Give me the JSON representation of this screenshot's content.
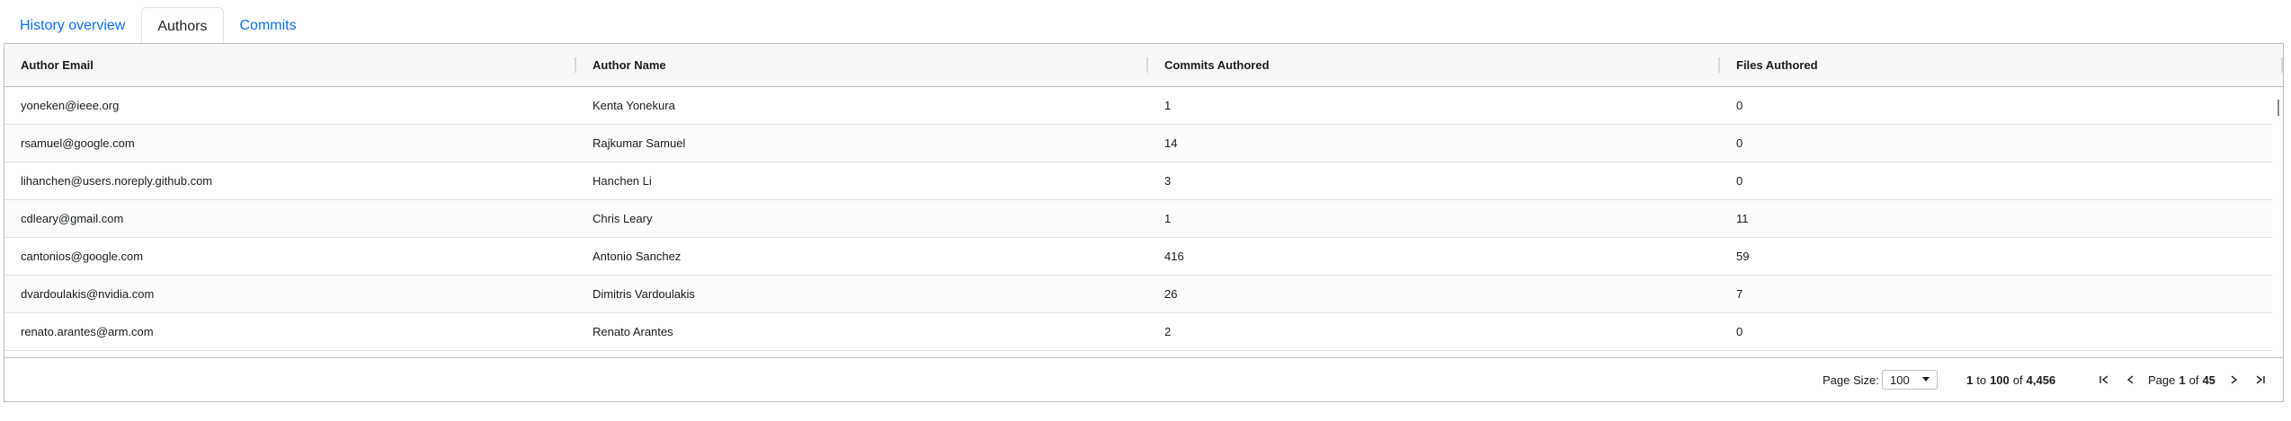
{
  "tabs": [
    {
      "label": "History overview",
      "active": false
    },
    {
      "label": "Authors",
      "active": true
    },
    {
      "label": "Commits",
      "active": false
    }
  ],
  "columns": [
    "Author Email",
    "Author Name",
    "Commits Authored",
    "Files Authored"
  ],
  "rows": [
    [
      "yoneken@ieee.org",
      "Kenta Yonekura",
      "1",
      "0"
    ],
    [
      "rsamuel@google.com",
      "Rajkumar Samuel",
      "14",
      "0"
    ],
    [
      "lihanchen@users.noreply.github.com",
      "Hanchen Li",
      "3",
      "0"
    ],
    [
      "cdleary@gmail.com",
      "Chris Leary",
      "1",
      "11"
    ],
    [
      "cantonios@google.com",
      "Antonio Sanchez",
      "416",
      "59"
    ],
    [
      "dvardoulakis@nvidia.com",
      "Dimitris Vardoulakis",
      "26",
      "7"
    ],
    [
      "renato.arantes@arm.com",
      "Renato Arantes",
      "2",
      "0"
    ]
  ],
  "pagination": {
    "page_size_label": "Page Size:",
    "page_size_value": "100",
    "range_from": "1",
    "range_to_word": "to",
    "range_to": "100",
    "of_word": "of",
    "total": "4,456",
    "page_word": "Page",
    "current_page": "1",
    "total_pages": "45"
  },
  "icons": [
    "first-page-icon",
    "previous-page-icon",
    "next-page-icon",
    "last-page-icon",
    "chevron-down-icon"
  ],
  "colors": {
    "tab_link": "#0d6efd",
    "header_bg": "#f8f8f8",
    "border": "#babfc7"
  }
}
